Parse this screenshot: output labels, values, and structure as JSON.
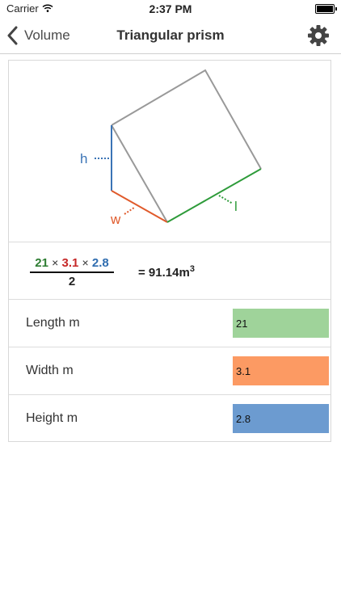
{
  "status": {
    "carrier": "Carrier",
    "time": "2:37 PM"
  },
  "nav": {
    "back_label": "Volume",
    "title": "Triangular prism"
  },
  "diagram": {
    "label_h": "h",
    "label_w": "w",
    "label_l": "l"
  },
  "formula": {
    "length": "21",
    "width": "3.1",
    "height": "2.8",
    "times1": "×",
    "times2": "×",
    "denominator": "2",
    "result": "= 91.14m",
    "result_exp": "3"
  },
  "fields": {
    "length": {
      "label": "Length m",
      "value": "21"
    },
    "width": {
      "label": "Width m",
      "value": "3.1"
    },
    "height": {
      "label": "Height m",
      "value": "2.8"
    }
  },
  "colors": {
    "length": "#2e9b3a",
    "width": "#e05a2b",
    "height": "#3b74b6",
    "length_field": "#9fd39a",
    "width_field": "#fc9a63",
    "height_field": "#6c9bd0",
    "edge_gray": "#999999",
    "formula_length": "#2e7d32",
    "formula_width": "#c62828",
    "formula_height": "#2f6db0"
  }
}
